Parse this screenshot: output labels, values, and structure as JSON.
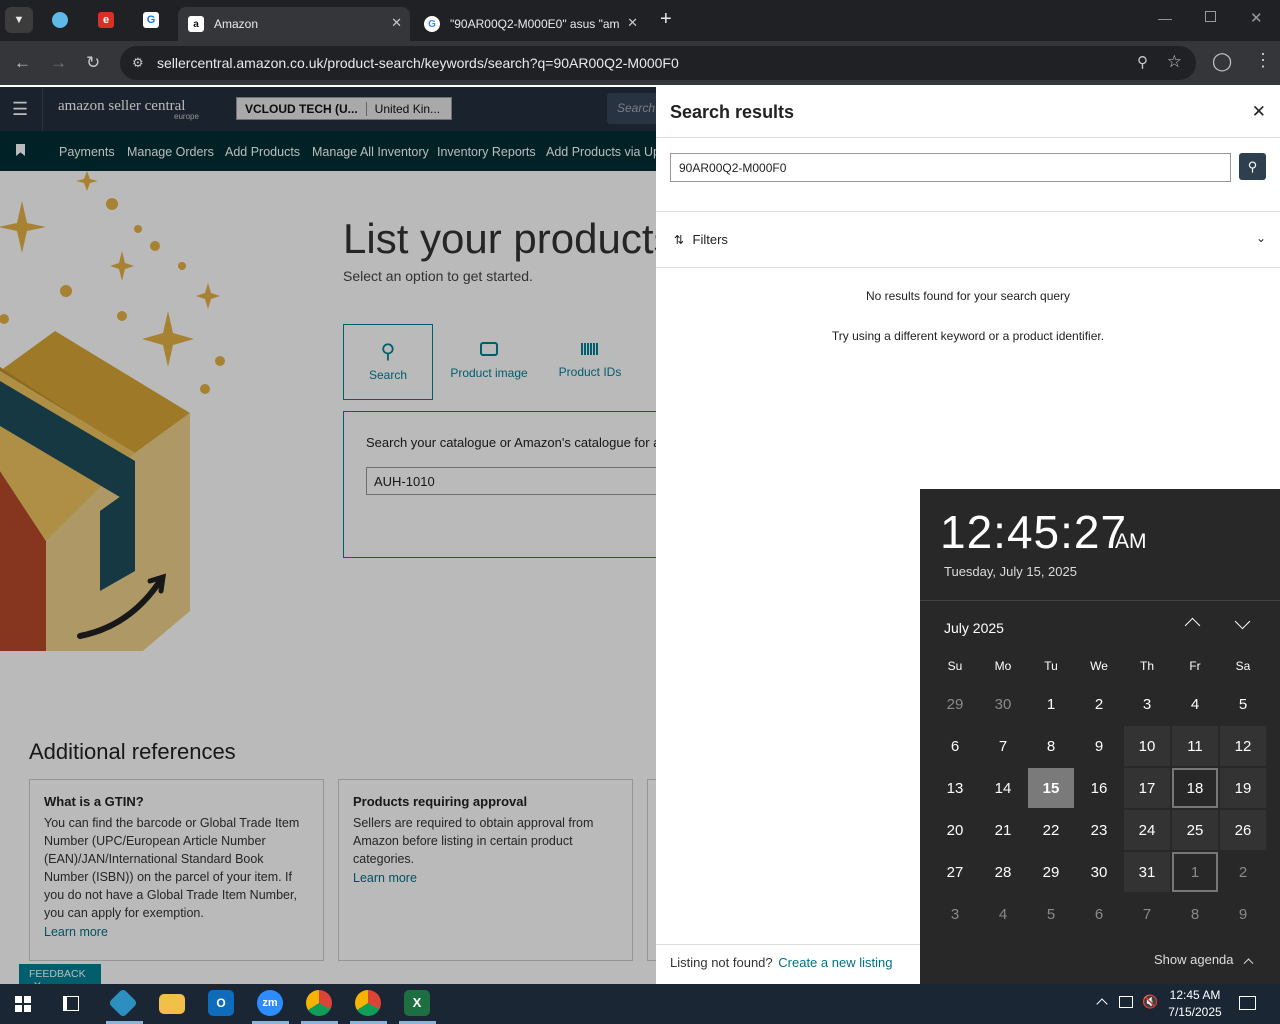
{
  "browser": {
    "tabs": [
      {
        "title": "Amazon",
        "active": true
      },
      {
        "title": "\"90AR00Q2-M000E0\" asus \"am...",
        "active": false
      }
    ],
    "url": "sellercentral.amazon.co.uk/product-search/keywords/search?q=90AR00Q2-M000F0",
    "new_tab": "+"
  },
  "seller_central": {
    "logo_main": "amazon seller central",
    "logo_sub": "europe",
    "account": "VCLOUD TECH (U...",
    "marketplace": "United Kin...",
    "search_placeholder": "Search",
    "nav": [
      "Payments",
      "Manage Orders",
      "Add Products",
      "Manage All Inventory",
      "Inventory Reports",
      "Add Products via Upl"
    ]
  },
  "main": {
    "title": "List your products",
    "subtitle": "Select an option to get started.",
    "options": [
      {
        "label": "Search",
        "icon": "search-icon"
      },
      {
        "label": "Product image",
        "icon": "camera-icon"
      },
      {
        "label": "Product IDs",
        "icon": "barcode-icon"
      }
    ],
    "search_prompt": "Search your catalogue or Amazon's catalogue for a",
    "search_value": "AUH-1010",
    "references_title": "Additional references",
    "cards": [
      {
        "title": "What is a GTIN?",
        "body": "You can find the barcode or Global Trade Item Number (UPC/European Article Number (EAN)/JAN/International Standard Book Number (ISBN)) on the parcel of your item. If you do not have a Global Trade Item Number, you can apply for exemption.",
        "link": "Learn more"
      },
      {
        "title": "Products requiring approval",
        "body": "Sellers are required to obtain approval from Amazon before listing in certain product categories.",
        "link": "Learn more"
      }
    ],
    "feedback": "FEEDBACK"
  },
  "panel": {
    "title": "Search results",
    "query": "90AR00Q2-M000F0",
    "filters_label": "Filters",
    "no_results": "No results found for your search query",
    "hint": "Try using a different keyword or a product identifier.",
    "footer_text": "Listing not found?",
    "footer_link": "Create a new listing"
  },
  "clock": {
    "time": "12:45:27",
    "ampm": "AM",
    "date": "Tuesday, July 15, 2025",
    "month": "July 2025",
    "weekdays": [
      "Su",
      "Mo",
      "Tu",
      "We",
      "Th",
      "Fr",
      "Sa"
    ],
    "weeks": [
      [
        "29",
        "30",
        "1",
        "2",
        "3",
        "4",
        "5"
      ],
      [
        "6",
        "7",
        "8",
        "9",
        "10",
        "11",
        "12"
      ],
      [
        "13",
        "14",
        "15",
        "16",
        "17",
        "18",
        "19"
      ],
      [
        "20",
        "21",
        "22",
        "23",
        "24",
        "25",
        "26"
      ],
      [
        "27",
        "28",
        "29",
        "30",
        "31",
        "1",
        "2"
      ],
      [
        "3",
        "4",
        "5",
        "6",
        "7",
        "8",
        "9"
      ]
    ],
    "today": "15",
    "show_agenda": "Show agenda"
  },
  "taskbar": {
    "time": "12:45 AM",
    "date": "7/15/2025"
  },
  "colors": {
    "chrome_dark": "#202124",
    "seller_header": "#232f3e",
    "seller_nav": "#002f36",
    "teal": "#008296",
    "link": "#007185",
    "calendar_bg": "#282828",
    "today_bg": "#7a7a7a"
  }
}
